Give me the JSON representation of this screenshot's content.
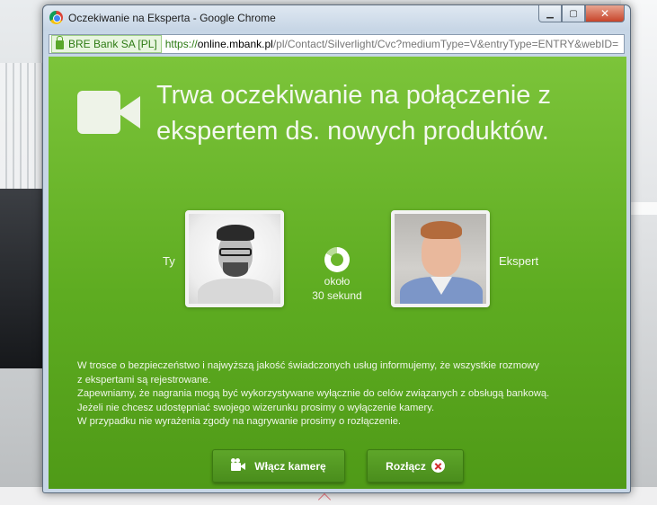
{
  "window": {
    "title": "Oczekiwanie na Eksperta - Google Chrome",
    "icon": "chrome-icon",
    "controls": {
      "minimize": "▁",
      "restore": "▢",
      "close": "✕"
    }
  },
  "address_bar": {
    "ssl_label": "BRE Bank SA [PL]",
    "url_scheme": "https://",
    "url_host": "online.mbank.pl",
    "url_path": "/pl/Contact/Silverlight/Cvc?mediumType=V&entryType=ENTRY&webID="
  },
  "content": {
    "headline": "Trwa oczekiwanie na połączenie z ekspertem ds. nowych produktów.",
    "you_label": "Ty",
    "expert_label": "Ekspert",
    "wait_line1": "około",
    "wait_line2": "30 sekund",
    "notice": [
      "W trosce o bezpieczeństwo i najwyższą jakość świadczonych usług informujemy, że wszystkie rozmowy",
      "z ekspertami są rejestrowane.",
      "Zapewniamy, że nagrania mogą być wykorzystywane wyłącznie do celów związanych z obsługą bankową.",
      "Jeżeli nie chcesz udostępniać swojego wizerunku prosimy o wyłączenie kamery.",
      "W przypadku nie wyrażenia zgody na nagrywanie prosimy o rozłączenie."
    ],
    "buttons": {
      "camera": "Włącz kamerę",
      "disconnect": "Rozłącz"
    }
  },
  "colors": {
    "green_top": "#7cc43a",
    "green_bottom": "#4f9a17",
    "button_green": "#4a8d1c",
    "disconnect_x": "#d22c2c"
  }
}
